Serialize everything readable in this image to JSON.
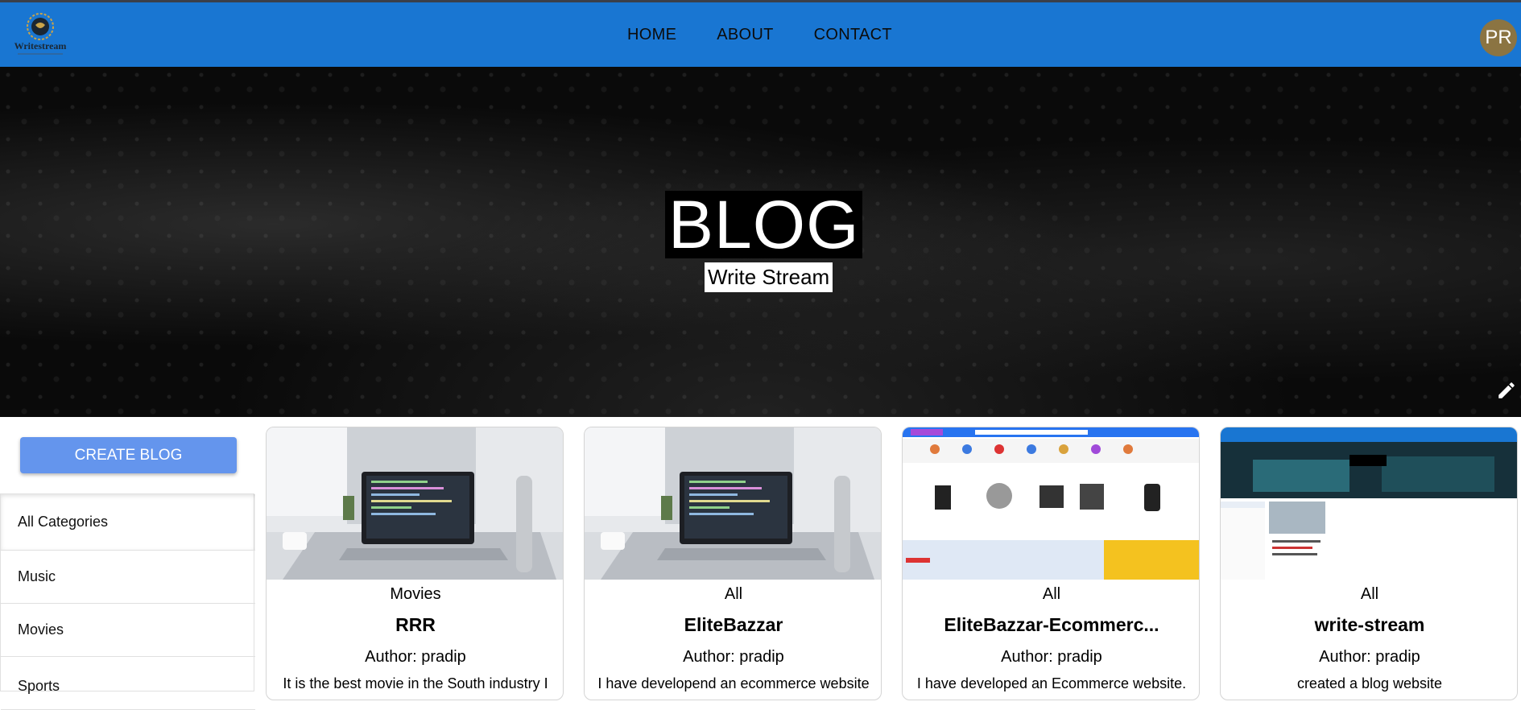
{
  "navbar": {
    "logo_text": "Writestream",
    "links": [
      "HOME",
      "ABOUT",
      "CONTACT"
    ],
    "avatar_initials": "PR"
  },
  "hero": {
    "title": "BLOG",
    "subtitle": "Write Stream"
  },
  "sidebar": {
    "create_label": "CREATE BLOG",
    "categories": [
      "All Categories",
      "Music",
      "Movies",
      "Sports"
    ]
  },
  "posts": [
    {
      "category": "Movies",
      "title": "RRR",
      "author": "Author: pradip",
      "description": "It is the best movie in the South industry I",
      "image": "laptop-desk-photo"
    },
    {
      "category": "All",
      "title": "EliteBazzar",
      "author": "Author: pradip",
      "description": "I have developend an ecommerce website",
      "image": "laptop-desk-photo"
    },
    {
      "category": "All",
      "title": "EliteBazzar-Ecommerc...",
      "author": "Author: pradip",
      "description": "I have developed an Ecommerce website.",
      "image": "ecommerce-screenshot"
    },
    {
      "category": "All",
      "title": "write-stream",
      "author": "Author: pradip",
      "description": "created a blog website",
      "image": "blog-screenshot"
    }
  ],
  "colors": {
    "navbar": "#1976d2",
    "create_button": "#6495ed",
    "avatar": "#8b7442"
  }
}
